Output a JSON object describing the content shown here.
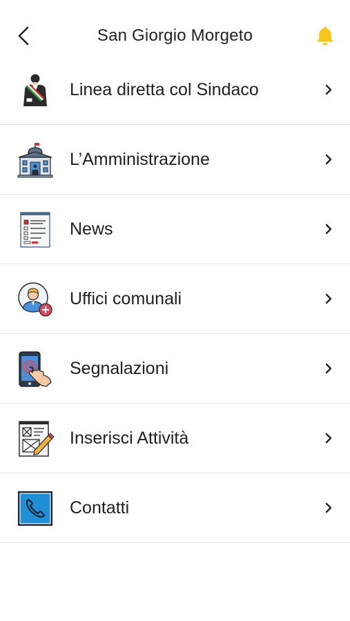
{
  "header": {
    "title": "San Giorgio Morgeto",
    "back_icon": "chevron-left-icon",
    "bell_icon": "bell-icon",
    "bell_color": "#F5C518"
  },
  "menu": {
    "items": [
      {
        "label": "Linea diretta col Sindaco",
        "icon": "mayor-icon"
      },
      {
        "label": "L’Amministrazione",
        "icon": "town-hall-icon"
      },
      {
        "label": "News",
        "icon": "news-icon"
      },
      {
        "label": "Uffici comunali",
        "icon": "office-user-icon"
      },
      {
        "label": "Segnalazioni",
        "icon": "phone-touch-icon"
      },
      {
        "label": "Inserisci Attività",
        "icon": "form-edit-icon"
      },
      {
        "label": "Contatti",
        "icon": "phone-contact-icon"
      }
    ]
  }
}
